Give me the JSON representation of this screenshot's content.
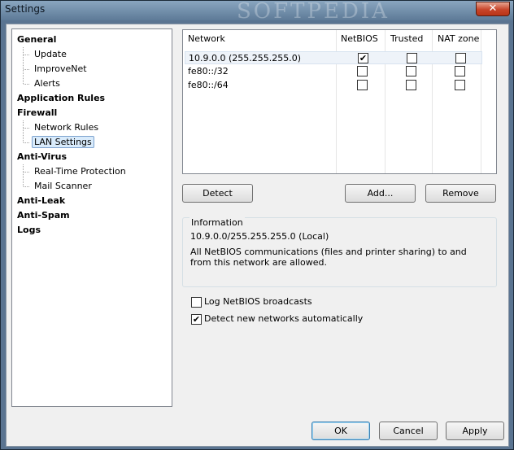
{
  "window": {
    "title": "Settings",
    "watermark": "SOFTPEDIA",
    "close_glyph": "✕"
  },
  "tree": {
    "items": [
      {
        "label": "General",
        "level": 0
      },
      {
        "label": "Update",
        "level": 1
      },
      {
        "label": "ImproveNet",
        "level": 1
      },
      {
        "label": "Alerts",
        "level": 1
      },
      {
        "label": "Application Rules",
        "level": 0
      },
      {
        "label": "Firewall",
        "level": 0
      },
      {
        "label": "Network Rules",
        "level": 1
      },
      {
        "label": "LAN Settings",
        "level": 1,
        "selected": true
      },
      {
        "label": "Anti-Virus",
        "level": 0
      },
      {
        "label": "Real-Time Protection",
        "level": 1
      },
      {
        "label": "Mail Scanner",
        "level": 1
      },
      {
        "label": "Anti-Leak",
        "level": 0
      },
      {
        "label": "Anti-Spam",
        "level": 0
      },
      {
        "label": "Logs",
        "level": 0
      }
    ]
  },
  "networks": {
    "columns": [
      "Network",
      "NetBIOS",
      "Trusted",
      "NAT zone"
    ],
    "rows": [
      {
        "network": "10.9.0.0 (255.255.255.0)",
        "netbios": true,
        "trusted": false,
        "nat": false
      },
      {
        "network": "fe80::/32",
        "netbios": false,
        "trusted": false,
        "nat": false
      },
      {
        "network": "fe80::/64",
        "netbios": false,
        "trusted": false,
        "nat": false
      }
    ]
  },
  "buttons": {
    "detect": "Detect",
    "add": "Add...",
    "remove": "Remove",
    "ok": "OK",
    "cancel": "Cancel",
    "apply": "Apply"
  },
  "info": {
    "title": "Information",
    "network": "10.9.0.0/255.255.255.0 (Local)",
    "description": "All NetBIOS communications (files and printer sharing) to and from this network are allowed."
  },
  "options": {
    "log_netbios": {
      "label": "Log NetBIOS broadcasts",
      "checked": false
    },
    "detect_networks": {
      "label": "Detect new networks automatically",
      "checked": true
    }
  }
}
